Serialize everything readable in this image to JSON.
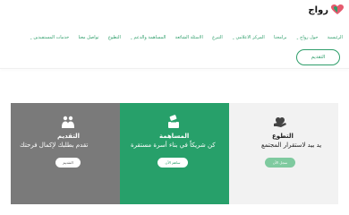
{
  "brand": {
    "name": "رواج",
    "accent": "#2e9e6a",
    "icon": "heart-logo-icon"
  },
  "nav": {
    "items": [
      {
        "label": "الرئيسية",
        "dropdown": false
      },
      {
        "label": "حول رواج",
        "dropdown": true
      },
      {
        "label": "برامجنا",
        "dropdown": false
      },
      {
        "label": "المركز الاعلامي",
        "dropdown": true
      },
      {
        "label": "التبرع",
        "dropdown": false
      },
      {
        "label": "الاسئلة الشائعة",
        "dropdown": false
      },
      {
        "label": "المساهمة والدعم",
        "dropdown": true
      },
      {
        "label": "التطوع",
        "dropdown": false
      },
      {
        "label": "تواصل معنا",
        "dropdown": false
      },
      {
        "label": "خدمات المستفيدين",
        "dropdown": true
      }
    ],
    "chevron_icon": "chevron-down-icon"
  },
  "cta": {
    "label": "التقديم"
  },
  "cards": [
    {
      "variant": "light",
      "icon": "heart-hand-icon",
      "title": "التطوع",
      "desc": "يد بيد لاستقرار المجتمع",
      "button": "سجل الآن",
      "color": "#f2f2f2"
    },
    {
      "variant": "green",
      "icon": "donation-box-icon",
      "title": "المساهمة",
      "desc": "كن شريكاً في بناء أسرة مستقرة",
      "button": "ساهم الآن",
      "color": "#27a06a"
    },
    {
      "variant": "gray",
      "icon": "couple-icon",
      "title": "التقديم",
      "desc": "تقدم بطلبك لإكمال فرحتك",
      "button": "التقديم",
      "color": "#7a7a7a"
    }
  ]
}
